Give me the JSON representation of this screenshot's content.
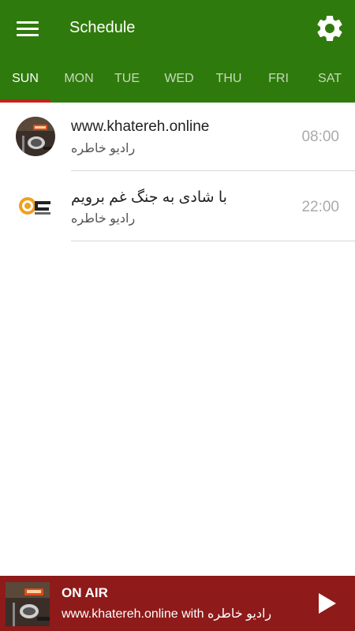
{
  "header": {
    "title": "Schedule"
  },
  "tabs": [
    {
      "label": "SUN",
      "active": true
    },
    {
      "label": "MON"
    },
    {
      "label": "TUE"
    },
    {
      "label": "WED"
    },
    {
      "label": "THU"
    },
    {
      "label": "FRI"
    },
    {
      "label": "SAT"
    }
  ],
  "schedule": [
    {
      "title": "www.khatereh.online",
      "subtitle": "رادیو خاطره",
      "time": "08:00",
      "thumb": "studio-microphone-image"
    },
    {
      "title": "با شادی به جنگ غم برویم",
      "subtitle": "رادیو خاطره",
      "time": "22:00",
      "thumb": "khatereh-logo-image"
    }
  ],
  "player": {
    "status": "ON AIR",
    "now_playing": "www.khatereh.online with رادیو خاطره",
    "thumb": "studio-microphone-image"
  },
  "colors": {
    "appbar": "#2f7a0c",
    "tab_indicator": "#c81e1e",
    "player_bar": "#8e1a1a"
  },
  "icons": {
    "menu": "hamburger-menu-icon",
    "settings": "gear-icon",
    "play": "play-icon"
  }
}
